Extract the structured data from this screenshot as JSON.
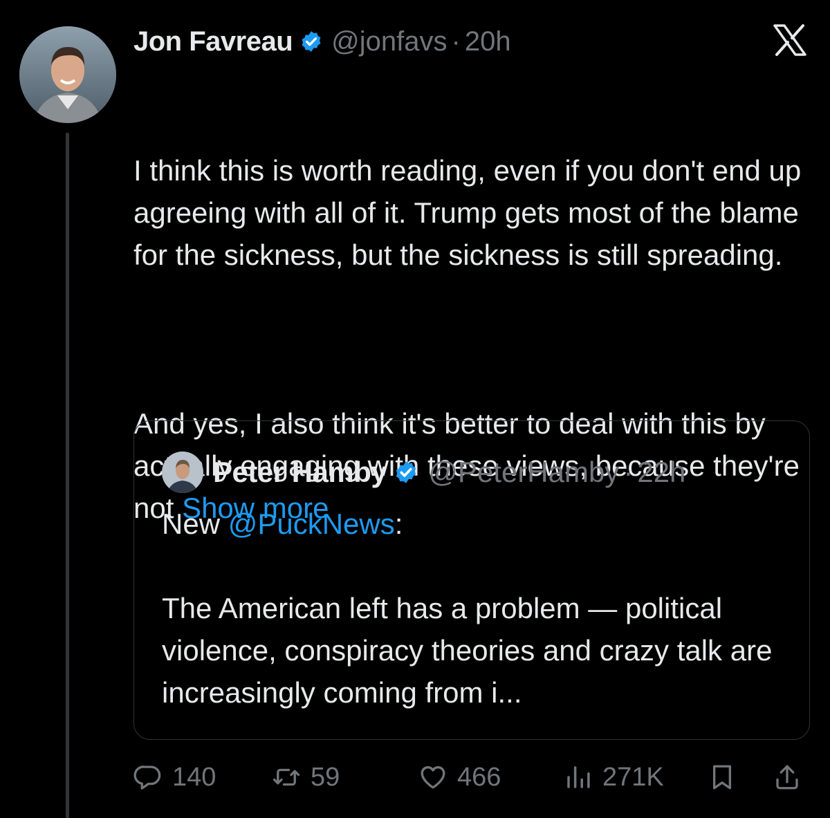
{
  "author": {
    "name": "Jon Favreau",
    "handle": "@jonfavs",
    "separator": "·",
    "time": "20h",
    "verified_icon": "verified-badge-icon"
  },
  "tweet": {
    "paragraph1": "I think this is worth reading, even if you don't end up agreeing with all of it. Trump gets most of the blame for the sickness, but the sickness is still spreading.",
    "paragraph2": "And yes, I also think it's better to deal with this by actually engaging with these views, because they're not ",
    "show_more": "Show more"
  },
  "quote": {
    "name": "Peter Hamby",
    "handle": "@PeterHamby",
    "separator": "·",
    "time": "22h",
    "line1_prefix": "New ",
    "mention": "@PuckNews",
    "line1_suffix": ":",
    "paragraph2": "The American left has a problem — political violence, conspiracy theories and crazy talk are increasingly coming from i..."
  },
  "actions": {
    "replies": "140",
    "reposts": "59",
    "likes": "466",
    "views": "271K"
  },
  "colors": {
    "background": "#000000",
    "text": "#e7e9ea",
    "muted": "#71767b",
    "accent": "#1d9bf0"
  }
}
